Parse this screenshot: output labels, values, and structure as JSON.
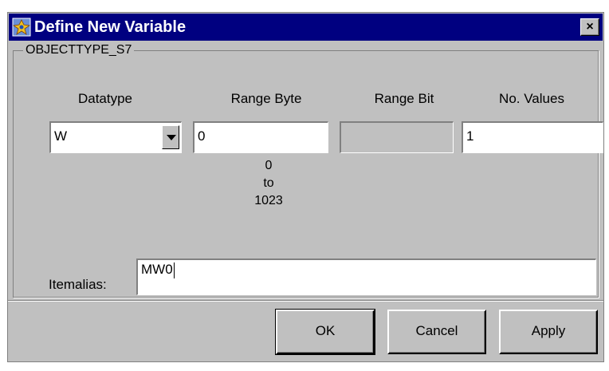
{
  "window": {
    "title": "Define New Variable",
    "close_label": "×"
  },
  "group": {
    "title": "OBJECTTYPE_S7"
  },
  "columns": {
    "datatype": "Datatype",
    "range_byte": "Range Byte",
    "range_bit": "Range Bit",
    "no_values": "No. Values"
  },
  "fields": {
    "datatype": "W",
    "range_byte": "0",
    "range_bit": "",
    "no_values": "1"
  },
  "range_note": {
    "min": "0",
    "to": "to",
    "max": "1023"
  },
  "itemalias": {
    "label": "Itemalias:",
    "value": "MW0"
  },
  "buttons": {
    "ok": "OK",
    "cancel": "Cancel",
    "apply": "Apply"
  },
  "icons": {
    "app": "app-icon",
    "dropdown": "chevron-down-icon"
  },
  "colors": {
    "titlebar": "#000080",
    "dialog": "#c0c0c0"
  }
}
